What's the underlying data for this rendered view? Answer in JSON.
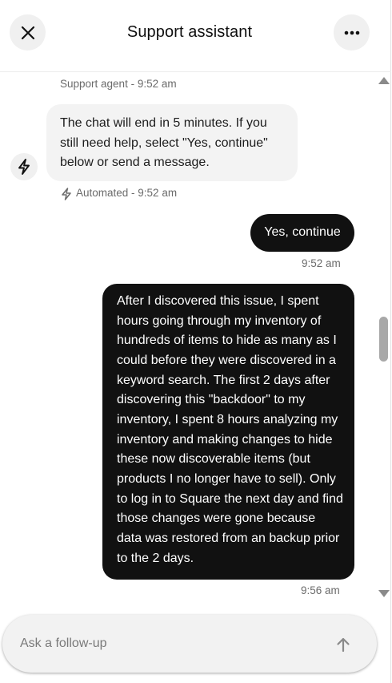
{
  "header": {
    "title": "Support assistant",
    "close_icon": "close-icon",
    "more_icon": "more-horizontal-icon"
  },
  "messages": {
    "agent_meta": "Support agent - 9:52 am",
    "agent_bubble": "The chat will end in 5 minutes. If you still need help, select \"Yes, continue\" below or send a message.",
    "auto_meta": "Automated - 9:52 am",
    "auto_icon": "lightning-icon",
    "user_reply": "Yes, continue",
    "user_reply_time": "9:52 am",
    "user_long": "After I discovered this issue, I spent hours going through my inventory of hundreds of items to hide as many as I could before they were discovered in a keyword search. The first 2 days after discovering this \"backdoor\" to my inventory, I spent 8 hours analyzing my inventory and making changes to hide these now discoverable items (but products I no longer have to sell). Only to log in to Square the next day and find those changes were gone because data was restored from an backup prior to the 2 days.",
    "user_long_time": "9:56 am"
  },
  "composer": {
    "placeholder": "Ask a follow-up",
    "value": "",
    "send_icon": "arrow-up-icon"
  },
  "colors": {
    "user_bubble": "#111111",
    "agent_bubble": "#f3f3f3",
    "meta_text": "#6b6b6b"
  }
}
